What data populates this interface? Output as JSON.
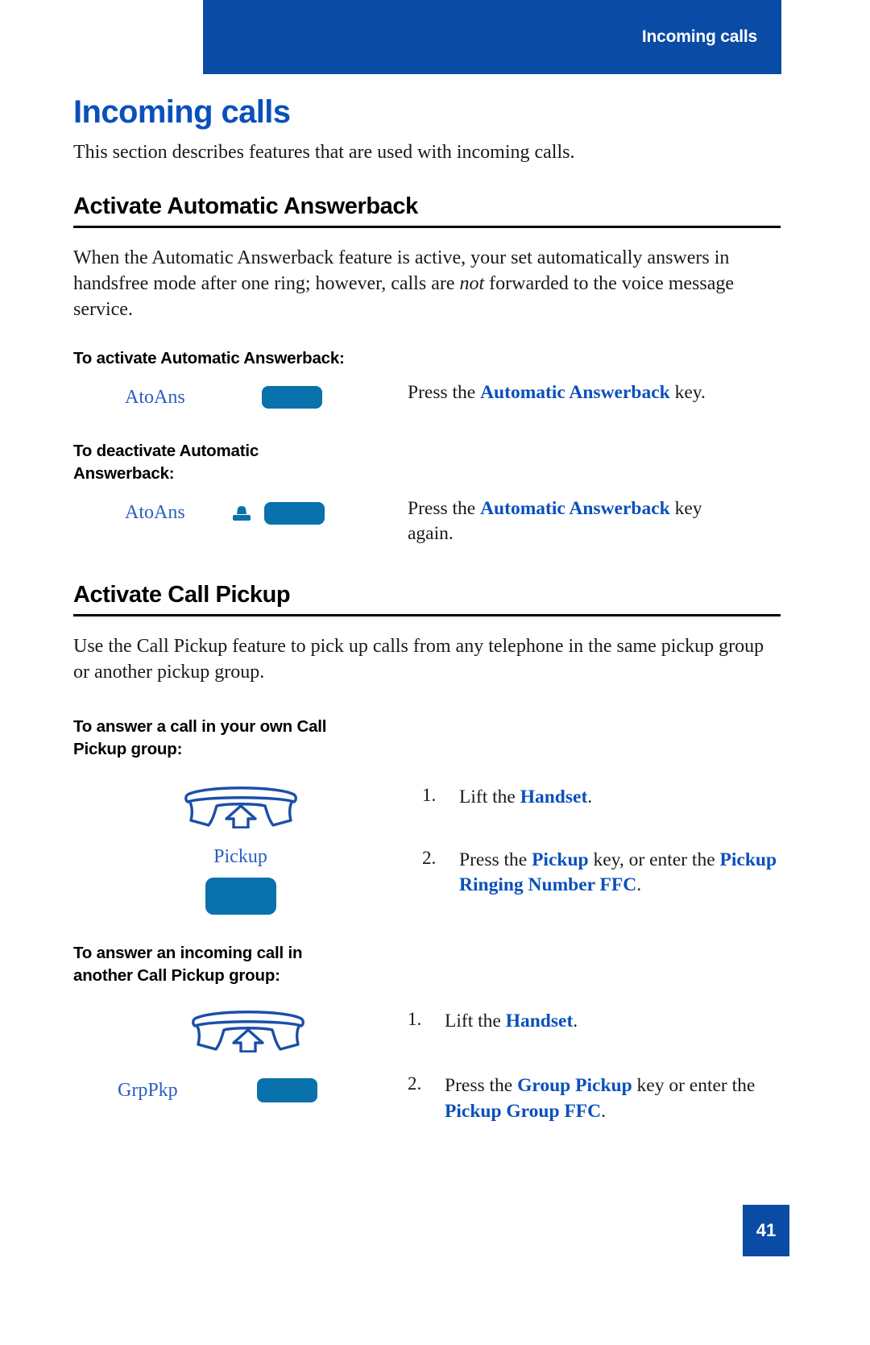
{
  "header": {
    "running_head": "Incoming calls",
    "bar_color": "#0a4ba5"
  },
  "page": {
    "title": "Incoming calls",
    "title_color": "#0a50ba",
    "intro": "This section describes features that are used with incoming calls.",
    "folio": "41"
  },
  "sections": [
    {
      "heading": "Activate Automatic Answerback",
      "body": {
        "part1": "When the Automatic Answerback feature is active, your set automatically answers in handsfree mode after one ring; however, calls are ",
        "emphasis": "not",
        "part2": " forwarded to the voice message service."
      },
      "subsections": [
        {
          "subhead": "To activate Automatic Answerback:",
          "key_label": "AtoAns",
          "has_led": false,
          "instruction": {
            "prefix": "Press the ",
            "bold": "Automatic Answerback",
            "suffix": " key."
          }
        },
        {
          "subhead": "To deactivate Automatic Answerback:",
          "key_label": "AtoAns",
          "has_led": true,
          "instruction": {
            "prefix": "Press the ",
            "bold": "Automatic Answerback",
            "suffix": " key again."
          }
        }
      ]
    },
    {
      "heading": "Activate Call Pickup",
      "body": {
        "part1": "Use the Call Pickup feature to pick up calls from any telephone in the same pickup group or another pickup group.",
        "emphasis": "",
        "part2": ""
      },
      "subsections": [
        {
          "subhead": "To answer a call in your own Call Pickup group:",
          "steps": [
            {
              "num": "1.",
              "icon": "handset-lift-icon",
              "key_label": "",
              "text_prefix": "Lift the ",
              "text_bold": "Handset",
              "text_suffix": "."
            },
            {
              "num": "2.",
              "icon": "",
              "key_label": "Pickup",
              "text_prefix": "Press the ",
              "text_bold": "Pickup",
              "text_mid": " key, or enter the ",
              "text_bold2": "Pickup Ringing Number FFC",
              "text_suffix": "."
            }
          ]
        },
        {
          "subhead": "To answer an incoming call in another Call Pickup group:",
          "steps": [
            {
              "num": "1.",
              "icon": "handset-lift-icon",
              "key_label": "",
              "text_prefix": "Lift the ",
              "text_bold": "Handset",
              "text_suffix": "."
            },
            {
              "num": "2.",
              "icon": "",
              "key_label": "GrpPkp",
              "text_prefix": "Press the ",
              "text_bold": "Group Pickup",
              "text_mid": " key or enter the ",
              "text_bold2": "Pickup Group FFC",
              "text_suffix": "."
            }
          ]
        }
      ]
    }
  ],
  "colors": {
    "brand_blue": "#0a4ba5",
    "link_blue": "#0a50ba",
    "key_blue": "#0971ab",
    "label_blue": "#2a5fc0"
  }
}
